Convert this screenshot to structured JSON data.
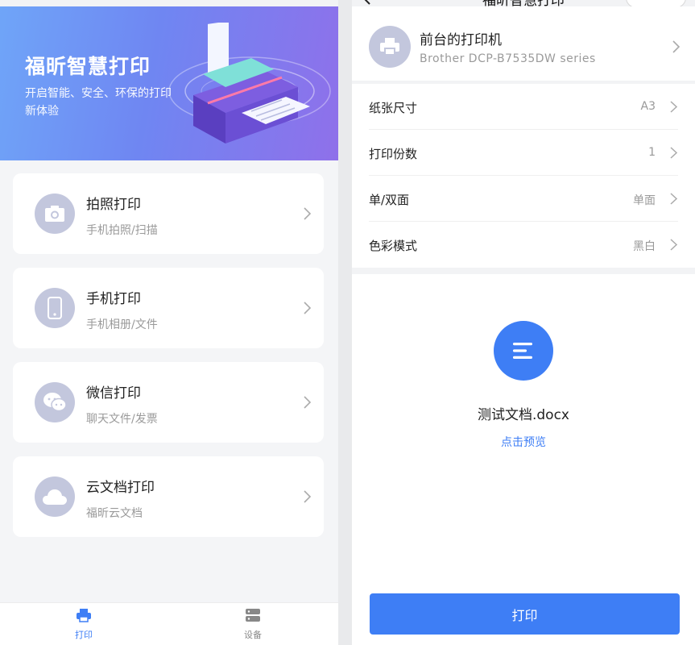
{
  "home": {
    "banner": {
      "title": "福昕智慧打印",
      "subtitle": "开启智能、安全、环保的打印新体验"
    },
    "menu": [
      {
        "title": "拍照打印",
        "subtitle": "手机拍照/扫描",
        "icon": "camera-icon"
      },
      {
        "title": "手机打印",
        "subtitle": "手机相册/文件",
        "icon": "phone-icon"
      },
      {
        "title": "微信打印",
        "subtitle": "聊天文件/发票",
        "icon": "wechat-icon"
      },
      {
        "title": "云文档打印",
        "subtitle": "福昕云文档",
        "icon": "cloud-icon"
      }
    ],
    "tabbar": {
      "print_label": "打印",
      "device_label": "设备",
      "active_color": "#3e7ef5",
      "inactive_color": "#888888"
    }
  },
  "print_page": {
    "nav_title": "福昕智慧打印",
    "printer": {
      "name": "前台的打印机",
      "model": "Brother DCP-B7535DW series"
    },
    "settings": [
      {
        "label": "纸张尺寸",
        "value": "A3"
      },
      {
        "label": "打印份数",
        "value": "1"
      },
      {
        "label": "单/双面",
        "value": "单面"
      },
      {
        "label": "色彩模式",
        "value": "黑白"
      }
    ],
    "document": {
      "name": "测试文档.docx",
      "preview_label": "点击预览",
      "icon": "document-icon"
    },
    "print_button_label": "打印",
    "accent_color": "#3e7ef5"
  }
}
